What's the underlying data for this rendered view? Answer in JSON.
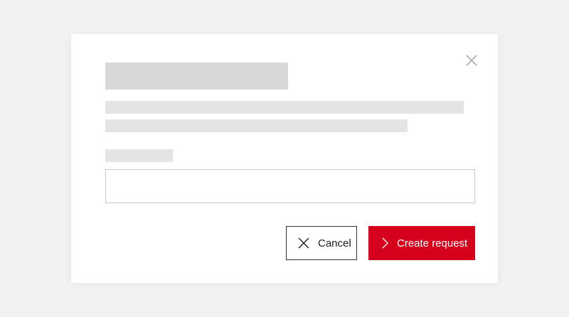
{
  "modal": {
    "close_icon": "close-icon",
    "input": {
      "value": "",
      "placeholder": ""
    },
    "actions": {
      "cancel_label": "Cancel",
      "cancel_icon": "close-icon",
      "create_label": "Create request",
      "create_icon": "chevron-right-icon"
    },
    "colors": {
      "primary": "#d5001c",
      "background": "#f2f2f2",
      "skeleton_dark": "#d8d8d8",
      "skeleton_light": "#e4e4e4"
    }
  }
}
